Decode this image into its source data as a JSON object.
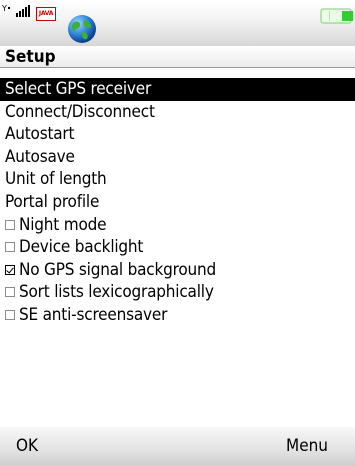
{
  "status_bar": {
    "java_label": "JAVA",
    "icons": [
      "signal-strength-icon",
      "java-icon",
      "globe-icon",
      "battery-icon"
    ]
  },
  "title": "Setup",
  "menu": {
    "items": [
      {
        "label": "Select GPS receiver",
        "selected": true
      },
      {
        "label": "Connect/Disconnect"
      },
      {
        "label": "Autostart"
      },
      {
        "label": "Autosave"
      },
      {
        "label": "Unit of length"
      },
      {
        "label": "Portal profile"
      },
      {
        "label": "Night mode",
        "checkbox": true,
        "checked": false
      },
      {
        "label": "Device backlight",
        "checkbox": true,
        "checked": false
      },
      {
        "label": "No GPS signal background",
        "checkbox": true,
        "checked": true
      },
      {
        "label": "Sort lists lexicographically",
        "checkbox": true,
        "checked": false
      },
      {
        "label": "SE anti-screensaver",
        "checkbox": true,
        "checked": false
      }
    ]
  },
  "softkeys": {
    "left": "OK",
    "right": "Menu"
  },
  "colors": {
    "selection_bg": "#000000",
    "selection_text": "#ffffff",
    "battery": "#33cc33"
  }
}
